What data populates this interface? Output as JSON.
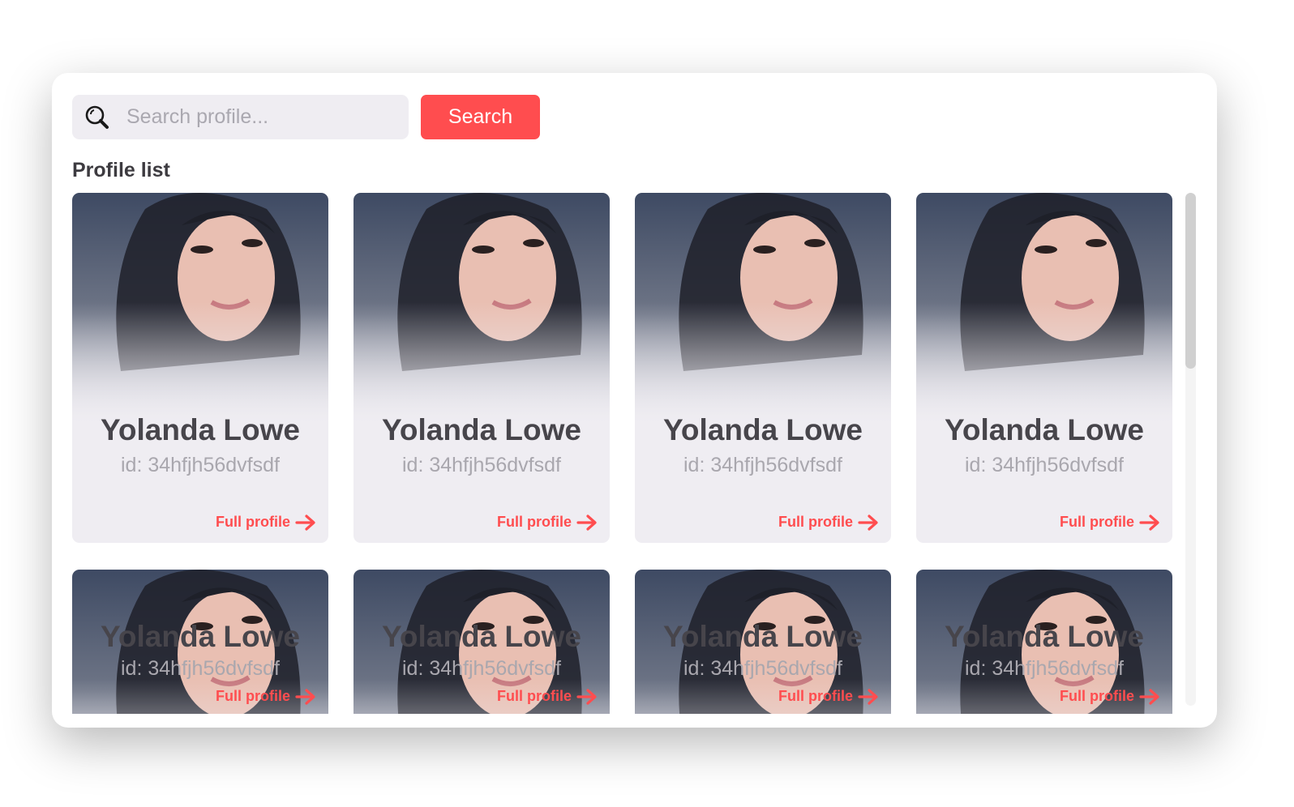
{
  "search": {
    "placeholder": "Search profile...",
    "value": "",
    "button_label": "Search",
    "icon": "search-icon"
  },
  "profile_list": {
    "title": "Profile list",
    "link_label": "Full profile",
    "profiles": [
      {
        "name": "Yolanda Lowe",
        "id": "id: 34hfjh56dvfsdf"
      },
      {
        "name": "Yolanda Lowe",
        "id": "id: 34hfjh56dvfsdf"
      },
      {
        "name": "Yolanda Lowe",
        "id": "id: 34hfjh56dvfsdf"
      },
      {
        "name": "Yolanda Lowe",
        "id": "id: 34hfjh56dvfsdf"
      },
      {
        "name": "Yolanda Lowe",
        "id": "id: 34hfjh56dvfsdf"
      },
      {
        "name": "Yolanda Lowe",
        "id": "id: 34hfjh56dvfsdf"
      },
      {
        "name": "Yolanda Lowe",
        "id": "id: 34hfjh56dvfsdf"
      },
      {
        "name": "Yolanda Lowe",
        "id": "id: 34hfjh56dvfsdf"
      }
    ]
  },
  "colors": {
    "accent": "#ff4d4f",
    "card_bg": "#efedf2"
  }
}
